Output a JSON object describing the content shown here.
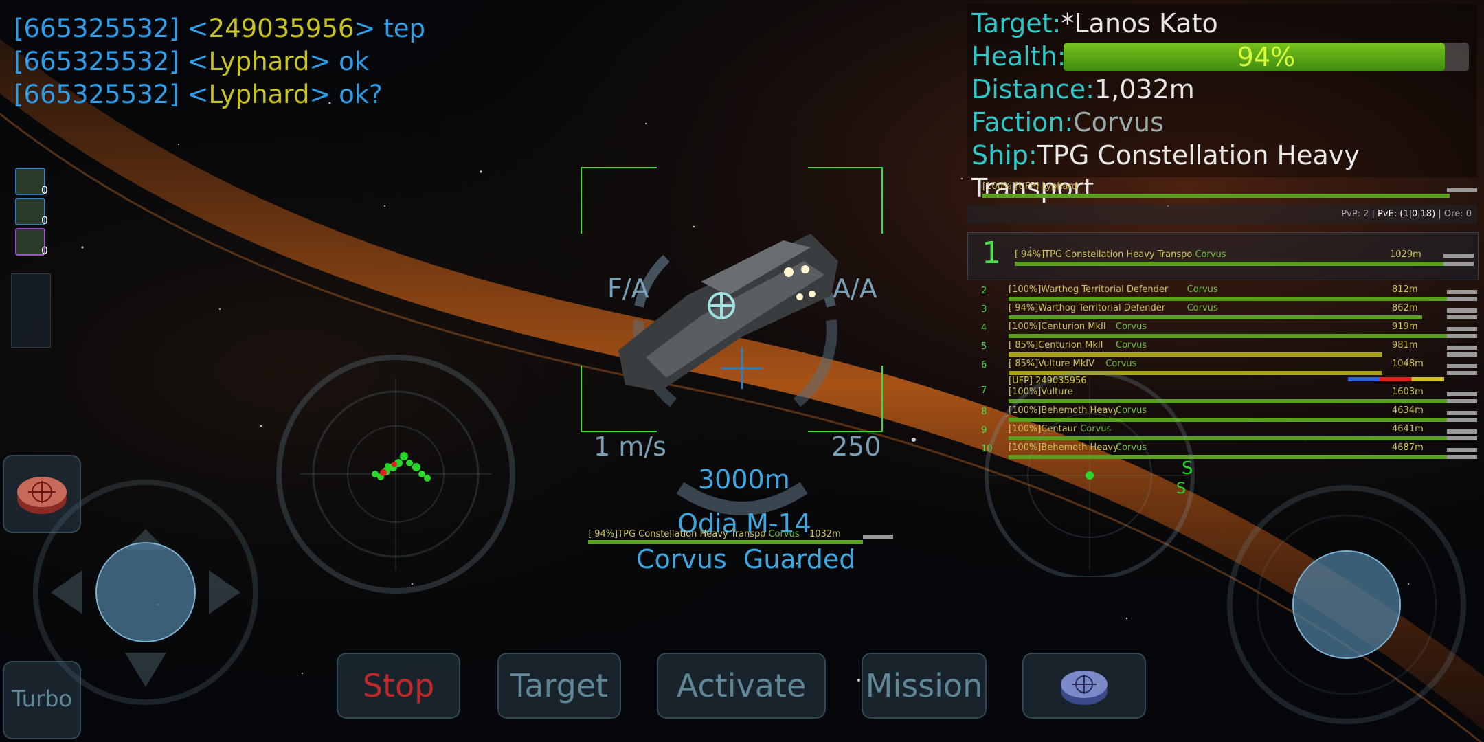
{
  "chat": [
    {
      "channel": "[665325532]",
      "nick": "249035956",
      "message": "tep"
    },
    {
      "channel": "[665325532]",
      "nick": "Lyphard",
      "message": "ok"
    },
    {
      "channel": "[665325532]",
      "nick": "Lyphard",
      "message": "ok?"
    }
  ],
  "target": {
    "target_label": "Target:",
    "target_value": "*Lanos Kato",
    "health_label": "Health:",
    "health_value": "94%",
    "health_fraction": 0.94,
    "distance_label": "Distance:",
    "distance_value": "1,032m",
    "faction_label": "Faction:",
    "faction_value": "Corvus",
    "ship_label": "Ship:",
    "ship_value": "TPG Constellation Heavy Transport"
  },
  "self_row": {
    "text": "[100%][UFP] Lyphard"
  },
  "stats": {
    "pvp": "PvP: 2",
    "pve": "PvE: (1|0|18)",
    "ore": "Ore: 0"
  },
  "selected_target": {
    "index": "1",
    "text": "[ 94%]TPG Constellation Heavy Transpo",
    "faction": "Corvus",
    "distance": "1029m"
  },
  "contacts": [
    {
      "index": "2",
      "text": "[100%]Warthog Territorial Defender",
      "faction": "Corvus",
      "distance": "812m",
      "color": "#5aa01e",
      "fill": 1.0
    },
    {
      "index": "3",
      "text": "[ 94%]Warthog Territorial Defender",
      "faction": "Corvus",
      "distance": "862m",
      "color": "#5aa01e",
      "fill": 0.94
    },
    {
      "index": "4",
      "text": "[100%]Centurion MkII",
      "faction": "Corvus",
      "distance": "919m",
      "color": "#5aa01e",
      "fill": 1.0
    },
    {
      "index": "5",
      "text": "[ 85%]Centurion MkII",
      "faction": "Corvus",
      "distance": "981m",
      "color": "#a9a21a",
      "fill": 0.85
    },
    {
      "index": "6",
      "text": "[ 85%]Vulture MkIV",
      "faction": "Corvus",
      "distance": "1048m",
      "color": "#a9a21a",
      "fill": 0.85
    }
  ],
  "group": {
    "index": "7",
    "header": "[UFP] 249035956",
    "text": "[100%]Vulture",
    "distance": "1603m"
  },
  "contacts2": [
    {
      "index": "8",
      "text": "[100%]Behemoth Heavy",
      "faction": "Corvus",
      "distance": "4634m"
    },
    {
      "index": "9",
      "text": "[100%]Centaur",
      "faction": "Corvus",
      "distance": "4641m"
    },
    {
      "index": "10",
      "text": "[100%]Behemoth Heavy",
      "faction": "Corvus",
      "distance": "4687m"
    }
  ],
  "hud": {
    "fa": "F/A",
    "aa": "A/A",
    "speed": "1 m/s",
    "ammo": "250",
    "range": "3000m",
    "target_name": "Odia M-14",
    "faction_status": "Corvus  Guarded",
    "mini_target": "[ 94%]TPG Constellation Heavy Transpo",
    "mini_faction": "Corvus",
    "mini_distance": "1032m"
  },
  "cargo": [
    {
      "count": "0"
    },
    {
      "count": "0"
    },
    {
      "count": "0"
    }
  ],
  "buttons": {
    "stop": "Stop",
    "target": "Target",
    "activate": "Activate",
    "mission": "Mission",
    "turbo": "Turbo"
  },
  "colors": {
    "accent": "#2fc7c7",
    "chat_blue": "#2f9ee8",
    "chat_nick": "#c8c31e",
    "stop_red": "#c0282a",
    "health_green": "#78c41c"
  }
}
